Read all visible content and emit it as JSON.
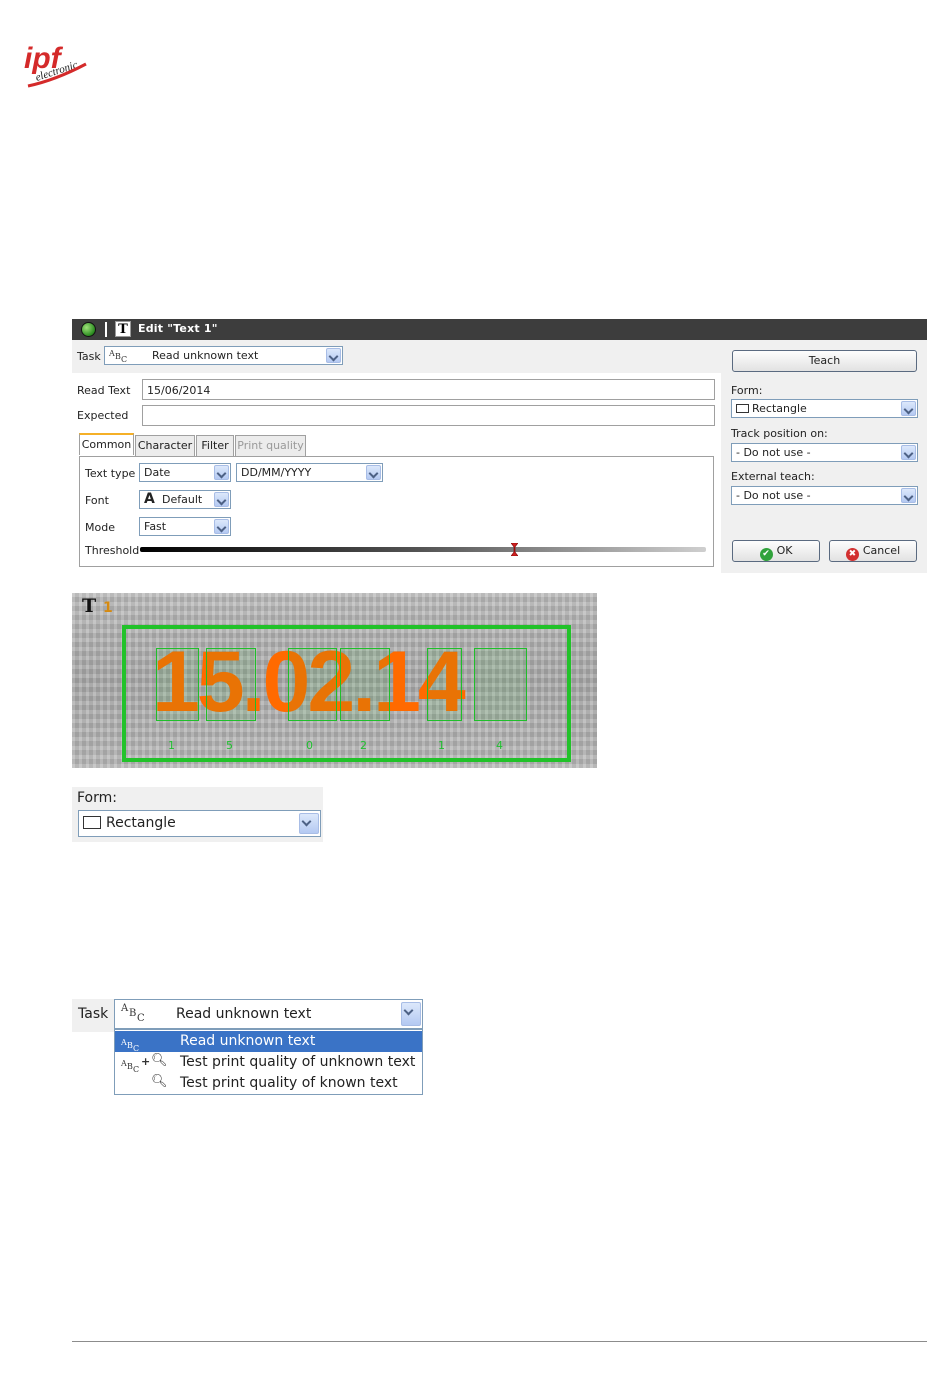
{
  "logo": {
    "text_main": "ipf",
    "text_sub": "electronic",
    "color": "#d42a2a"
  },
  "dialog": {
    "title": "Edit \"Text 1\"",
    "task": {
      "label": "Task",
      "value": "Read unknown text"
    },
    "read_text": {
      "label": "Read Text",
      "value": "15/06/2014"
    },
    "expected": {
      "label": "Expected",
      "value": ""
    },
    "tabs": [
      {
        "label": "Common",
        "state": "active"
      },
      {
        "label": "Character",
        "state": "normal"
      },
      {
        "label": "Filter",
        "state": "normal"
      },
      {
        "label": "Print quality",
        "state": "disabled"
      }
    ],
    "common": {
      "text_type": {
        "label": "Text type",
        "value": "Date",
        "format": "DD/MM/YYYY"
      },
      "font": {
        "label": "Font",
        "glyph": "A",
        "value": "Default"
      },
      "mode": {
        "label": "Mode",
        "value": "Fast"
      },
      "threshold": {
        "label": "Threshold",
        "level": 0.66
      }
    },
    "right": {
      "teach_label": "Teach",
      "form": {
        "label": "Form:",
        "value": "Rectangle"
      },
      "track": {
        "label": "Track position on:",
        "value": "- Do not use -"
      },
      "external": {
        "label": "External teach:",
        "value": "- Do not use -"
      },
      "ok_label": "OK",
      "cancel_label": "Cancel"
    }
  },
  "image": {
    "badge_letter": "T",
    "badge_index": "1",
    "read_value": "15.02.14",
    "char_labels": [
      "1",
      "5",
      "0",
      "2",
      "1",
      "4"
    ]
  },
  "form_snippet": {
    "label": "Form:",
    "value": "Rectangle"
  },
  "task_snippet": {
    "label": "Task",
    "value": "Read unknown text",
    "options": [
      "Read unknown text",
      "Test print quality of unknown text",
      "Test print quality of known text"
    ],
    "selected_index": 0
  },
  "abc_glyph": {
    "a": "A",
    "b": "B",
    "c": "C"
  }
}
